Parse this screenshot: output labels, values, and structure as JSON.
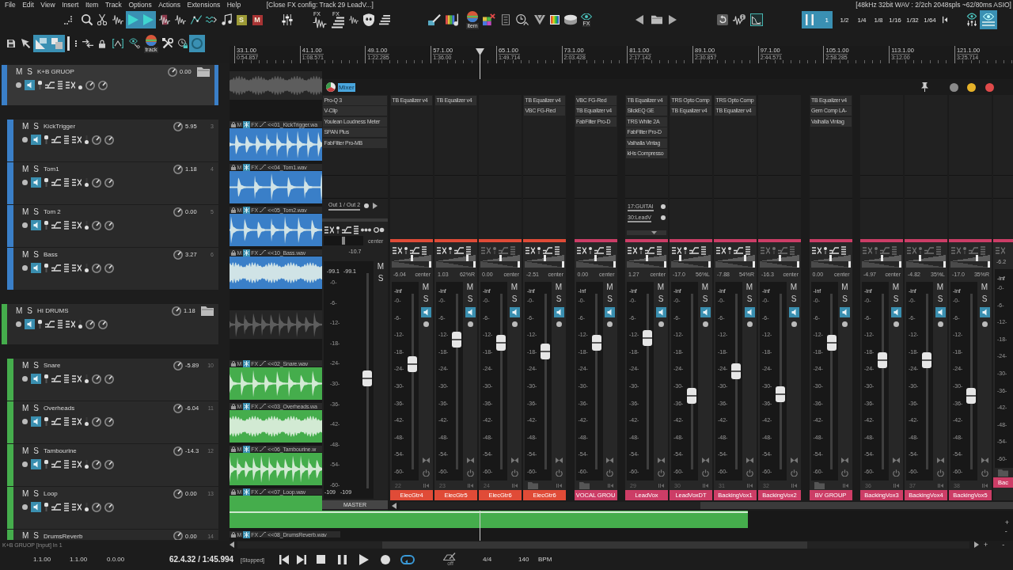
{
  "menu": {
    "items": [
      "File",
      "Edit",
      "View",
      "Insert",
      "Item",
      "Track",
      "Options",
      "Actions",
      "Extensions",
      "Help"
    ],
    "title": "[Close FX config: Track 29 LeadV...]",
    "status": "[48kHz 32bit WAV : 2/2ch 2048spls ~62/80ms ASIO]"
  },
  "toolbar": [
    {
      "on": false
    },
    {
      "on": false
    },
    {
      "on": false
    },
    {
      "on": false
    },
    {
      "on": true
    },
    {
      "on": true
    },
    {
      "on": false
    },
    {
      "on": false
    },
    {
      "on": false
    },
    {
      "on": false
    },
    {
      "on": false
    },
    {
      "label": "S",
      "on": false
    },
    {
      "label": "M",
      "on": false
    },
    {
      "on": false
    },
    {
      "label": "FX",
      "on": false
    },
    {
      "label": "FX",
      "on": false
    },
    {
      "on": false
    },
    {
      "on": false
    },
    {
      "on": false
    },
    {
      "on": false
    },
    {
      "on": false
    },
    {
      "label": "item",
      "on": false
    },
    {
      "on": false
    },
    {
      "on": false
    },
    {
      "on": false
    },
    {
      "on": false
    },
    {
      "on": false
    },
    {
      "on": false
    },
    {
      "label": "FX",
      "on": false
    },
    {
      "on": false
    },
    {
      "on": false
    },
    {
      "on": false
    },
    {
      "on": false
    },
    {
      "on": false
    },
    {
      "on": false
    },
    {
      "label": "1",
      "on": true
    },
    {
      "label": "1/2",
      "on": false
    },
    {
      "label": "1/4",
      "on": false
    },
    {
      "label": "1/8",
      "on": false
    },
    {
      "label": "1/16",
      "on": false
    },
    {
      "label": "1/32",
      "on": false
    },
    {
      "label": "1/64",
      "on": false
    },
    {
      "on": false
    },
    {
      "on": false
    },
    {
      "on": true
    }
  ],
  "toolbar_2": [
    {
      "on": false
    },
    {
      "on": false
    },
    {
      "on": true
    },
    {
      "on": true
    },
    {
      "on": false
    },
    {
      "on": false
    },
    {
      "on": false
    },
    {
      "on": false
    },
    {
      "on": false
    },
    {
      "label": "track",
      "on": false
    },
    {
      "on": false
    },
    {
      "on": false
    },
    {
      "on": true
    }
  ],
  "ruler": {
    "marks": [
      {
        "bar": "33.1.00",
        "time": "0:54.857"
      },
      {
        "bar": "41.1.00",
        "time": "1:08.571"
      },
      {
        "bar": "49.1.00",
        "time": "1:22.285"
      },
      {
        "bar": "57.1.00",
        "time": "1:36.00"
      },
      {
        "bar": "65.1.00",
        "time": "1:49.714"
      },
      {
        "bar": "73.1.00",
        "time": "2:03.428"
      },
      {
        "bar": "81.1.00",
        "time": "2:17.142"
      },
      {
        "bar": "89.1.00",
        "time": "2:30.857"
      },
      {
        "bar": "97.1.00",
        "time": "2:44.571"
      },
      {
        "bar": "105.1.00",
        "time": "2:58.285"
      },
      {
        "bar": "113.1.00",
        "time": "3:12.00"
      },
      {
        "bar": "121.1.00",
        "time": "3:25.714"
      }
    ]
  },
  "tracks": [
    {
      "kind": "folder",
      "name": "K+B GRUOP",
      "selected": true,
      "color": "#3a7fc8",
      "mute_label": "M",
      "solo_label": "S",
      "volume": "0.00",
      "children": [
        {
          "kind": "track",
          "name": "KickTrigger",
          "selected": false,
          "color": "#3a7fc8",
          "mute_label": "M",
          "solo_label": "S",
          "volume": "5.95",
          "number": "3",
          "item": {
            "name": "<<01_KickTrigger.wa",
            "mute_label": "M",
            "fx_label": "FX"
          }
        },
        {
          "kind": "track",
          "name": "Tom1",
          "selected": false,
          "color": "#3a7fc8",
          "mute_label": "M",
          "solo_label": "S",
          "volume": "1.18",
          "number": "4",
          "item": {
            "name": "<<04_Tom1.wav",
            "mute_label": "M",
            "fx_label": "FX"
          }
        },
        {
          "kind": "track",
          "name": "Tom 2",
          "selected": false,
          "color": "#3a7fc8",
          "mute_label": "M",
          "solo_label": "S",
          "volume": "0.00",
          "number": "5",
          "item": {
            "name": "<<05_Tom2.wav",
            "mute_label": "M",
            "fx_label": "FX"
          }
        },
        {
          "kind": "track",
          "name": "Bass",
          "selected": false,
          "color": "#3a7fc8",
          "mute_label": "M",
          "solo_label": "S",
          "volume": "3.27",
          "number": "6",
          "item": {
            "name": "<<10_Bass.wav",
            "mute_label": "M",
            "fx_label": "FX"
          }
        }
      ]
    },
    {
      "kind": "folder",
      "name": "HI DRUMS",
      "selected": false,
      "color": "#45ad4c",
      "mute_label": "M",
      "solo_label": "S",
      "volume": "1.18",
      "children": [
        {
          "kind": "track",
          "name": "Snare",
          "selected": false,
          "color": "#45ad4c",
          "mute_label": "M",
          "solo_label": "S",
          "volume": "-5.89",
          "number": "10",
          "item": {
            "name": "<<02_Snare.wav",
            "mute_label": "M",
            "fx_label": "FX"
          }
        },
        {
          "kind": "track",
          "name": "Overheads",
          "selected": false,
          "color": "#45ad4c",
          "mute_label": "M",
          "solo_label": "S",
          "volume": "-6.04",
          "number": "11",
          "item": {
            "name": "<<03_Overheads.wa",
            "mute_label": "M",
            "fx_label": "FX"
          }
        },
        {
          "kind": "track",
          "name": "Tambourine",
          "selected": false,
          "color": "#45ad4c",
          "mute_label": "M",
          "solo_label": "S",
          "volume": "-14.3",
          "number": "12",
          "item": {
            "name": "<<06_Tambourine.w",
            "mute_label": "M",
            "fx_label": "FX"
          }
        },
        {
          "kind": "track",
          "name": "Loop",
          "selected": false,
          "color": "#45ad4c",
          "mute_label": "M",
          "solo_label": "S",
          "volume": "0.00",
          "number": "13",
          "item": {
            "name": "<<07_Loop.wav",
            "mute_label": "M",
            "fx_label": "FX"
          }
        },
        {
          "kind": "track",
          "name": "DrumsReverb",
          "selected": false,
          "color": "#45ad4c",
          "mute_label": "M",
          "solo_label": "S",
          "volume": "0.00",
          "number": "14",
          "item": {
            "name": "<<08_DrumsReverb.wav",
            "mute_label": "M",
            "fx_label": "FX"
          }
        }
      ]
    }
  ],
  "track_status": "K+B GRUOP [input] In 1",
  "arrange_zoom": {
    "vertical": [
      "+",
      "-"
    ],
    "horizontal": [
      "+",
      "-"
    ]
  },
  "mixer": {
    "title": "Mixer",
    "master": {
      "name": "MASTER",
      "fx": [
        "Pro-Q 3",
        "V-Clip",
        "Youlean Loudness Meter",
        "SPAN Plus",
        "FabFilter Pro-MB"
      ],
      "routing": "Out 1 / Out 2",
      "volume": "-10.7",
      "pan": {
        "level": 0.5,
        "reading": "center"
      },
      "peaks": [
        "-99.1",
        "-99.1"
      ],
      "scale": [
        "-0-",
        "-6-",
        "-12-",
        "-18-",
        "-24-",
        "-30-",
        "-36-",
        "-42-",
        "-48-",
        "-54-",
        "-60-"
      ],
      "floor": [
        "-109",
        "-109"
      ],
      "mute_label": "M",
      "solo_label": "S",
      "fader": {
        "level": 0.51
      }
    },
    "strip_groups": [
      {
        "strips": [
          {
            "kind": "track",
            "name": "ElecGtr4",
            "number": "22",
            "color": "#e04b37",
            "fx": [
              "TB Equalizer v4"
            ],
            "volume": "-6.04",
            "pan": {
              "level": 0.5,
              "reading": "center"
            },
            "width": {
              "level": 1
            },
            "peak": "-inf",
            "scale": [
              "-0-",
              "-6-",
              "-12-",
              "-18-",
              "-24-",
              "-30-",
              "-36-",
              "-42-",
              "-48-",
              "-54-",
              "-60-"
            ],
            "mute_label": "M",
            "solo_label": "S",
            "fader": {
              "level": 0.6
            }
          },
          {
            "kind": "track",
            "name": "ElecGtr5",
            "number": "23",
            "color": "#e04b37",
            "fx": [
              "TB Equalizer v4"
            ],
            "volume": "1.03",
            "pan": {
              "level": 0.81,
              "reading": "62%R"
            },
            "width": {
              "level": 1
            },
            "peak": "-inf",
            "scale": [
              "-0-",
              "-6-",
              "-12-",
              "-18-",
              "-24-",
              "-30-",
              "-36-",
              "-42-",
              "-48-",
              "-54-",
              "-60-"
            ],
            "mute_label": "M",
            "solo_label": "S",
            "fader": {
              "level": 0.74
            }
          },
          {
            "kind": "track",
            "name": "ElecGtr6",
            "number": "24",
            "color": "#e04b37",
            "volume": "0.00",
            "pan": {
              "level": 0.5,
              "reading": "center"
            },
            "width": {
              "level": 1
            },
            "peak": "-inf",
            "scale": [
              "-0-",
              "-6-",
              "-12-",
              "-18-",
              "-24-",
              "-30-",
              "-36-",
              "-42-",
              "-48-",
              "-54-",
              "-60-"
            ],
            "mute_label": "M",
            "solo_label": "S",
            "fader": {
              "level": 0.72
            }
          },
          {
            "kind": "folder",
            "name": "ElecGtr6",
            "color": "#e04b37",
            "fx": [
              "TB Equalizer v4",
              "VBC FG-Red"
            ],
            "volume": "-2.51",
            "pan": {
              "level": 0.5,
              "reading": "center"
            },
            "width": {
              "level": 1
            },
            "peak": "-inf",
            "scale": [
              "-0-",
              "-6-",
              "-12-",
              "-18-",
              "-24-",
              "-30-",
              "-36-",
              "-42-",
              "-48-",
              "-54-",
              "-60-"
            ],
            "mute_label": "M",
            "solo_label": "S",
            "fader": {
              "level": 0.67
            }
          }
        ]
      },
      {
        "strips": [
          {
            "kind": "folder",
            "name": "VOCAL GROU",
            "color": "#cc3d66",
            "fx": [
              "VBC FG-Red",
              "TB Equalizer v4",
              "FabFilter Pro-D"
            ],
            "volume": "0.00",
            "pan": {
              "level": 0.5,
              "reading": "center"
            },
            "width": {
              "level": 1
            },
            "peak": "-inf",
            "scale": [
              "-0-",
              "-6-",
              "-12-",
              "-18-",
              "-24-",
              "-30-",
              "-36-",
              "-42-",
              "-48-",
              "-54-",
              "-60-"
            ],
            "mute_label": "M",
            "solo_label": "S",
            "fader": {
              "level": 0.72
            }
          }
        ]
      },
      {
        "strips": [
          {
            "kind": "track",
            "name": "LeadVox",
            "number": "29",
            "color": "#cc3d66",
            "fx": [
              "TB Equalizer v4",
              "SlickEQ GE",
              "TRS White 2A",
              "FabFilter Pro-D",
              "Valhalla Vintag",
              "kHs Compresso"
            ],
            "sends": [
              "17:GUITAI",
              "30:LeadV"
            ],
            "volume": "1.27",
            "pan": {
              "level": 0.5,
              "reading": "center"
            },
            "width": {
              "level": 1
            },
            "peak": "-inf",
            "scale": [
              "-0-",
              "-6-",
              "-12-",
              "-18-",
              "-24-",
              "-30-",
              "-36-",
              "-42-",
              "-48-",
              "-54-",
              "-60-"
            ],
            "mute_label": "M",
            "solo_label": "S",
            "fader": {
              "level": 0.75
            }
          },
          {
            "kind": "track",
            "name": "LeadVoxDT",
            "number": "30",
            "color": "#cc3d66",
            "fx": [
              "TRS Opto Comp",
              "TB Equalizer v4"
            ],
            "volume": "-17.0",
            "pan": {
              "level": 0.22,
              "reading": "56%L"
            },
            "width": {
              "level": 1
            },
            "peak": "-inf",
            "scale": [
              "-0-",
              "-6-",
              "-12-",
              "-18-",
              "-24-",
              "-30-",
              "-36-",
              "-42-",
              "-48-",
              "-54-",
              "-60-"
            ],
            "mute_label": "M",
            "solo_label": "S",
            "fader": {
              "level": 0.42
            }
          },
          {
            "kind": "track",
            "name": "BackingVox1",
            "number": "31",
            "color": "#cc3d66",
            "fx": [
              "TRS Opto Comp",
              "TB Equalizer v4"
            ],
            "volume": "-7.88",
            "pan": {
              "level": 0.77,
              "reading": "54%R"
            },
            "width": {
              "level": 1
            },
            "peak": "-inf",
            "scale": [
              "-0-",
              "-6-",
              "-12-",
              "-18-",
              "-24-",
              "-30-",
              "-36-",
              "-42-",
              "-48-",
              "-54-",
              "-60-"
            ],
            "mute_label": "M",
            "solo_label": "S",
            "fader": {
              "level": 0.56
            }
          },
          {
            "kind": "track",
            "name": "BackingVox2",
            "number": "32",
            "color": "#cc3d66",
            "volume": "-16.3",
            "pan": {
              "level": 0.5,
              "reading": "center"
            },
            "width": {
              "level": 1
            },
            "peak": "-inf",
            "scale": [
              "-0-",
              "-6-",
              "-12-",
              "-18-",
              "-24-",
              "-30-",
              "-36-",
              "-42-",
              "-48-",
              "-54-",
              "-60-"
            ],
            "mute_label": "M",
            "solo_label": "S",
            "fader": {
              "level": 0.43
            }
          }
        ]
      },
      {
        "strips": [
          {
            "kind": "folder",
            "name": "BV GROUP",
            "color": "#cc3d66",
            "fx": [
              "TB Equalizer v4",
              "Gem Comp LA-",
              "Valhalla Vintag"
            ],
            "volume": "0.00",
            "pan": {
              "level": 0.5,
              "reading": "center"
            },
            "width": {
              "level": 1
            },
            "peak": "-inf",
            "scale": [
              "-0-",
              "-6-",
              "-12-",
              "-18-",
              "-24-",
              "-30-",
              "-36-",
              "-42-",
              "-48-",
              "-54-",
              "-60-"
            ],
            "mute_label": "M",
            "solo_label": "S",
            "fader": {
              "level": 0.72
            }
          }
        ]
      },
      {
        "strips": [
          {
            "kind": "track",
            "name": "BackingVox3",
            "number": "36",
            "color": "#cc3d66",
            "volume": "-4.97",
            "pan": {
              "level": 0.5,
              "reading": "center"
            },
            "width": {
              "level": 1
            },
            "peak": "-inf",
            "scale": [
              "-0-",
              "-6-",
              "-12-",
              "-18-",
              "-24-",
              "-30-",
              "-36-",
              "-42-",
              "-48-",
              "-54-",
              "-60-"
            ],
            "mute_label": "M",
            "solo_label": "S",
            "fader": {
              "level": 0.62
            }
          },
          {
            "kind": "track",
            "name": "BackingVox4",
            "number": "37",
            "color": "#cc3d66",
            "volume": "-4.82",
            "pan": {
              "level": 0.33,
              "reading": "35%L"
            },
            "width": {
              "level": 1
            },
            "peak": "-inf",
            "scale": [
              "-0-",
              "-6-",
              "-12-",
              "-18-",
              "-24-",
              "-30-",
              "-36-",
              "-42-",
              "-48-",
              "-54-",
              "-60-"
            ],
            "mute_label": "M",
            "solo_label": "S",
            "fader": {
              "level": 0.62
            }
          },
          {
            "kind": "track",
            "name": "BackingVox5",
            "number": "38",
            "color": "#cc3d66",
            "volume": "-17.0",
            "pan": {
              "level": 0.68,
              "reading": "35%R"
            },
            "width": {
              "level": 1
            },
            "peak": "-inf",
            "scale": [
              "-0-",
              "-6-",
              "-12-",
              "-18-",
              "-24-",
              "-30-",
              "-36-",
              "-42-",
              "-48-",
              "-54-",
              "-60-"
            ],
            "mute_label": "M",
            "solo_label": "S",
            "fader": {
              "level": 0.42
            }
          },
          {
            "kind": "folder",
            "name": "Bac",
            "color": "#cc3d66",
            "volume": "-6.2",
            "peak": "-inf",
            "scale": [
              "-0-",
              "-6-",
              "-12-",
              "-18-",
              "-24-",
              "-30-",
              "-36-",
              "-42-",
              "-48-",
              "-54-",
              "-60-"
            ]
          }
        ]
      }
    ]
  },
  "transport": {
    "selection_start": "1.1.00",
    "selection_end": "1.1.00",
    "selection_length": "0.0.00",
    "position": "62.4.32 / 1:45.994",
    "play_state": "[Stopped]",
    "buttons": [
      {
        "on": false
      },
      {
        "on": false
      },
      {
        "on": false
      },
      {
        "on": false
      },
      {
        "on": false
      },
      {
        "on": false
      },
      {
        "on": true
      }
    ],
    "metronome": {
      "label": "off"
    },
    "time_signature": "4/4",
    "tempo": "140",
    "tempo_unit": "BPM"
  }
}
